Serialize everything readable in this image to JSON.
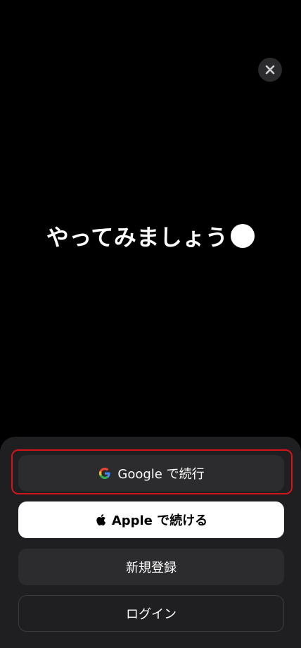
{
  "close": {
    "icon": "close-icon"
  },
  "headline": {
    "text": "やってみましょう"
  },
  "auth": {
    "google": {
      "label": "Google で続行",
      "icon": "google-icon"
    },
    "apple": {
      "label": "Apple で続ける",
      "icon": "apple-icon"
    },
    "signup": {
      "label": "新規登録"
    },
    "login": {
      "label": "ログイン"
    }
  },
  "colors": {
    "background": "#000000",
    "sheet": "#1f1f21",
    "button_dark": "#2c2c2e",
    "button_light": "#ffffff",
    "highlight": "#d4131a"
  }
}
